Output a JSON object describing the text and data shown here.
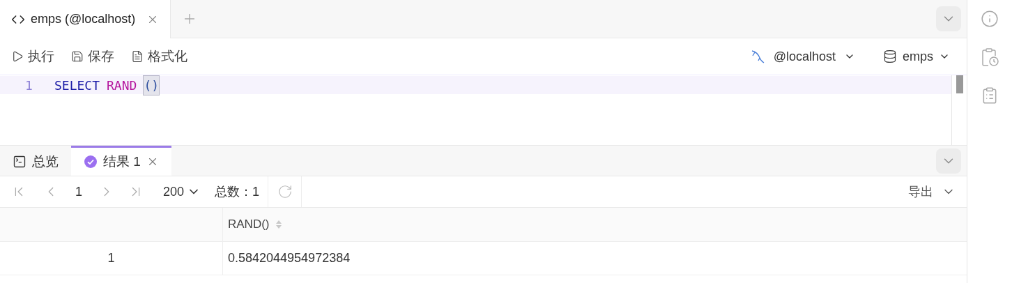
{
  "editor_tabs": [
    {
      "label": "emps (@localhost)",
      "selected": true
    }
  ],
  "toolbar": {
    "actions": [
      {
        "label": "执行",
        "kind": "run"
      },
      {
        "label": "保存",
        "kind": "save"
      },
      {
        "label": "格式化",
        "kind": "format"
      }
    ],
    "connection": "@localhost",
    "database": "emps"
  },
  "editor": {
    "lines": [
      {
        "number": "1",
        "current": true,
        "tokens": [
          {
            "text": "SELECT",
            "kind": "keyword"
          },
          {
            "text": "RAND",
            "kind": "function"
          },
          {
            "text": "()",
            "kind": "bracket"
          }
        ]
      }
    ]
  },
  "result_tabs": [
    {
      "label": "总览",
      "kind": "overview",
      "selected": false
    },
    {
      "label": "结果 1",
      "kind": "result",
      "selected": true
    }
  ],
  "pager": {
    "page": "1",
    "page_size": "200",
    "total": "总数：1",
    "export": "导出"
  },
  "table": {
    "columns": [
      "RAND()"
    ],
    "rows": [
      {
        "index": "1",
        "cells": [
          "0.5842044954972384"
        ]
      }
    ]
  }
}
